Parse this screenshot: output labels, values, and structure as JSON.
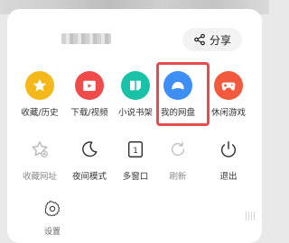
{
  "header": {
    "share_label": "分享"
  },
  "grid": {
    "row1": [
      {
        "label": "收藏/历史",
        "icon": "star-icon",
        "color": "#f5b81a"
      },
      {
        "label": "下载/视频",
        "icon": "play-folder-icon",
        "color": "#f04b4b"
      },
      {
        "label": "小说书架",
        "icon": "book-icon",
        "color": "#19c2a6"
      },
      {
        "label": "我的网盘",
        "icon": "cloud-icon",
        "color": "#3d8ef5"
      },
      {
        "label": "休闲游戏",
        "icon": "gamepad-icon",
        "color": "#f25a3e"
      }
    ],
    "row2": [
      {
        "label": "收藏网址",
        "icon": "add-star-icon"
      },
      {
        "label": "夜间模式",
        "icon": "moon-icon"
      },
      {
        "label": "多窗口",
        "icon": "window-count-icon",
        "badge": "1"
      },
      {
        "label": "刷新",
        "icon": "refresh-icon"
      },
      {
        "label": "退出",
        "icon": "power-icon"
      }
    ]
  },
  "footer": {
    "settings_label": "设置"
  }
}
